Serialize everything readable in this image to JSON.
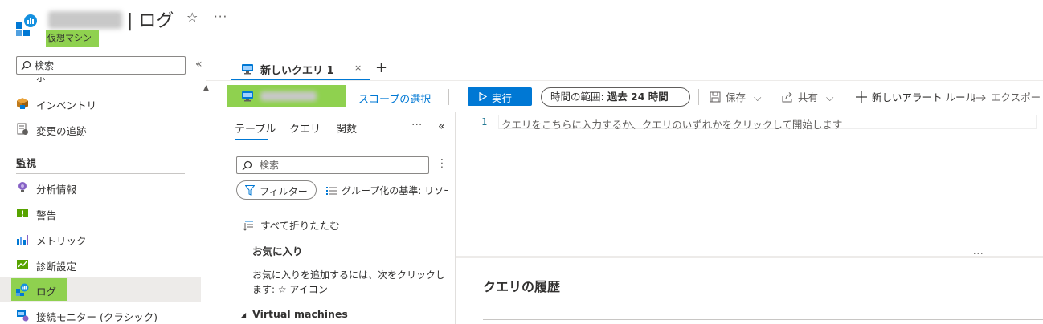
{
  "header": {
    "title": "| ログ",
    "subtitle": "仮想マシン",
    "favorite_glyph": "☆",
    "more_glyph": "···"
  },
  "nav": {
    "search_placeholder": "検索",
    "collapse_glyph": "«",
    "clipped_item_label": "ポリシー",
    "items": [
      {
        "label": "インベントリ",
        "icon": "inventory-icon"
      },
      {
        "label": "変更の追跡",
        "icon": "change-tracking-icon"
      }
    ],
    "section": "監視",
    "monitor_items": [
      {
        "label": "分析情報",
        "icon": "insights-icon"
      },
      {
        "label": "警告",
        "icon": "alerts-icon"
      },
      {
        "label": "メトリック",
        "icon": "metrics-icon"
      },
      {
        "label": "診断設定",
        "icon": "diagnostic-settings-icon"
      },
      {
        "label": "ログ",
        "icon": "logs-icon",
        "active": true
      },
      {
        "label": "接続モニター (クラシック)",
        "icon": "connection-monitor-icon"
      }
    ]
  },
  "tabs": {
    "active_label": "新しいクエリ 1",
    "close_glyph": "×",
    "add_glyph": "+"
  },
  "toolbar": {
    "scope_link": "スコープの選択",
    "run_label": "実行",
    "time_range_label": "時間の範囲:",
    "time_range_value": "過去 24 時間",
    "save_label": "保存",
    "share_label": "共有",
    "new_alert_label": "新しいアラート ルール",
    "export_label": "エクスポート"
  },
  "schema": {
    "tabs": [
      "テーブル",
      "クエリ",
      "関数"
    ],
    "more_glyph": "···",
    "collapse_glyph": "«",
    "search_placeholder": "検索",
    "filter_label": "フィルター",
    "group_by_label": "グループ化の基準: リソース",
    "collapse_all_label": "すべて折りたたむ",
    "favorites_title": "お気に入り",
    "favorites_help": "お気に入りを追加するには、次をクリックします: ☆ アイコン",
    "group_name": "Virtual machines"
  },
  "editor": {
    "line_number": "1",
    "placeholder": "クエリをこちらに入力するか、クエリのいずれかをクリックして開始します",
    "splitter_glyph": "···",
    "history_title": "クエリの履歴"
  },
  "colors": {
    "accent": "#0078d4",
    "highlight": "#8fd14f",
    "active_nav_bg": "#edebe9"
  }
}
